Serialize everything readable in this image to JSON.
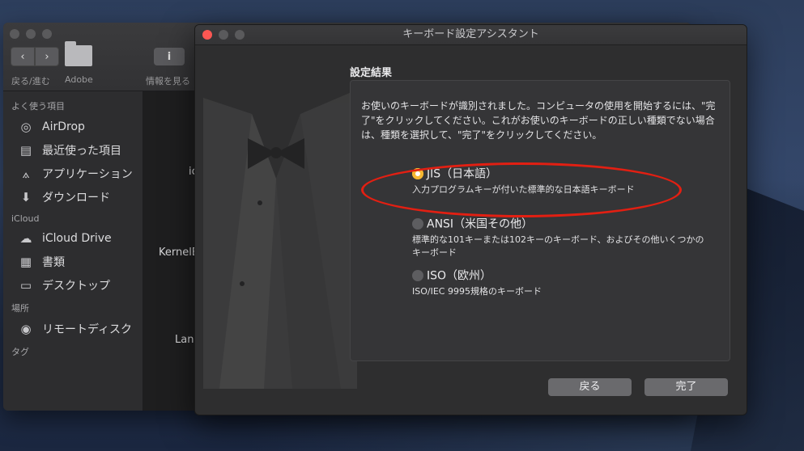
{
  "finder": {
    "toolbar": {
      "back_forward": "戻る/進む",
      "folder": "Adobe",
      "info": "情報を見る"
    },
    "sections": [
      {
        "label": "よく使う項目",
        "items": [
          {
            "label": "AirDrop",
            "icon": "airdrop-icon"
          },
          {
            "label": "最近使った項目",
            "icon": "recents-icon"
          },
          {
            "label": "アプリケーション",
            "icon": "applications-icon"
          },
          {
            "label": "ダウンロード",
            "icon": "downloads-icon"
          }
        ]
      },
      {
        "label": "iCloud",
        "items": [
          {
            "label": "iCloud Drive",
            "icon": "cloud-icon"
          },
          {
            "label": "書類",
            "icon": "documents-icon"
          },
          {
            "label": "デスクトップ",
            "icon": "desktop-icon"
          }
        ]
      },
      {
        "label": "場所",
        "items": [
          {
            "label": "リモートディスク",
            "icon": "disc-icon"
          }
        ]
      },
      {
        "label": "タグ",
        "items": []
      }
    ],
    "pane_text": [
      "ic",
      "KernelE",
      "Lang"
    ]
  },
  "dialog": {
    "title": "キーボード設定アシスタント",
    "heading": "設定結果",
    "description": "お使いのキーボードが識別されました。コンピュータの使用を開始するには、\"完了\"をクリックしてください。これがお使いのキーボードの正しい種類でない場合は、種類を選択して、\"完了\"をクリックしてください。",
    "options": [
      {
        "title": "JIS（日本語）",
        "sub": "入力プログラムキーが付いた標準的な日本語キーボード",
        "selected": true
      },
      {
        "title": "ANSI（米国その他）",
        "sub1": "標準的な101キーまたは102キーのキーボード、およびその他いくつかの",
        "sub2": "キーボード",
        "selected": false
      },
      {
        "title": "ISO（欧州）",
        "sub": "ISO/IEC 9995規格のキーボード",
        "selected": false
      }
    ],
    "back_label": "戻る",
    "done_label": "完了"
  },
  "colors": {
    "accent": "#f5b731",
    "annotation": "#e21f12"
  }
}
